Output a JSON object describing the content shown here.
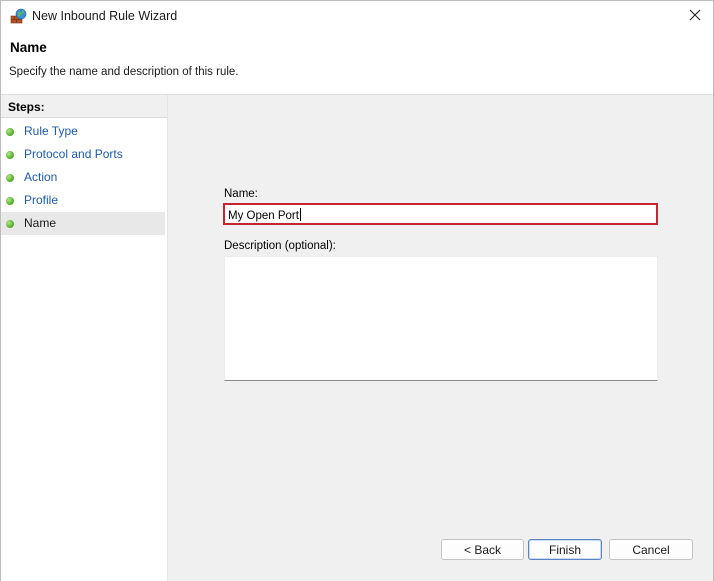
{
  "window": {
    "title": "New Inbound Rule Wizard",
    "app_icon": "firewall-globe-icon",
    "close_icon": "close-icon"
  },
  "header": {
    "title": "Name",
    "description": "Specify the name and description of this rule."
  },
  "steps": {
    "heading": "Steps:",
    "items": [
      {
        "label": "Rule Type",
        "current": false
      },
      {
        "label": "Protocol and Ports",
        "current": false
      },
      {
        "label": "Action",
        "current": false
      },
      {
        "label": "Profile",
        "current": false
      },
      {
        "label": "Name",
        "current": true
      }
    ]
  },
  "form": {
    "name_label": "Name:",
    "name_value": "My Open Port",
    "description_label": "Description (optional):",
    "description_value": ""
  },
  "buttons": {
    "back": "< Back",
    "finish": "Finish",
    "cancel": "Cancel"
  },
  "colors": {
    "accent_highlight": "#c8232f",
    "step_link": "#1f5aa8",
    "step_dot": "#5ab02e"
  }
}
